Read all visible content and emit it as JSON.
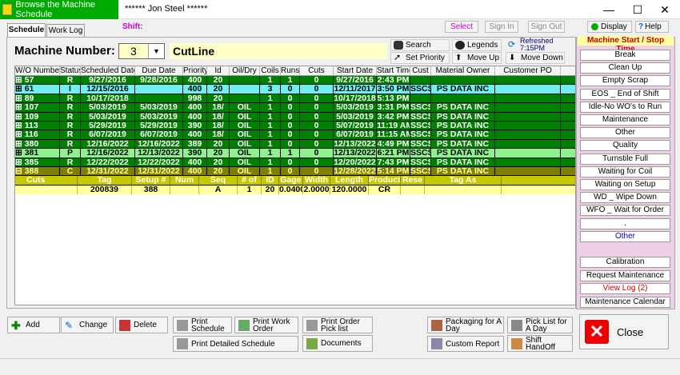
{
  "window": {
    "title": "Browse the Machine Schedule",
    "user": "****** Jon Steel ******",
    "minimize": "—",
    "maximize": "☐",
    "close": "✕"
  },
  "top_buttons": {
    "select": "Select",
    "sign_in": "Sign In",
    "sign_out": "Sign Out",
    "display": "Display",
    "help": "Help"
  },
  "shift_label": "Shift:",
  "tabs": [
    "Schedule",
    "Work Log"
  ],
  "machine": {
    "label": "Machine Number:",
    "value": "3",
    "name": "CutLine"
  },
  "toolbar": {
    "search": "Search",
    "set_priority": "Set Priority",
    "legends": "Legends",
    "move_up": "Move Up",
    "move_down": "Move Down",
    "refreshed": "Refreshed 7:15PM"
  },
  "grid": {
    "columns": [
      "W/O Number",
      "Status",
      "Scheduled Date",
      "Due Date",
      "Priority",
      "Id",
      "Oil/Dry",
      "Coils",
      "Runs",
      "Cuts",
      "Start Date",
      "Start Time",
      "Cust",
      "Material Owner",
      "Customer PO"
    ],
    "rows": [
      {
        "cells": [
          "57",
          "R",
          "9/27/2016",
          "9/28/2016",
          "400",
          "20",
          "",
          "1",
          "1",
          "0",
          "9/27/2016",
          "2:43 PM",
          "",
          "",
          ""
        ],
        "bg": "#008000",
        "fg": "#fff"
      },
      {
        "cells": [
          "61",
          "I",
          "12/15/2016",
          "",
          "400",
          "20",
          "",
          "3",
          "0",
          "0",
          "12/11/2017",
          "3:50 PM",
          "SSCS",
          "PS DATA INC",
          ""
        ],
        "bg": "#70f0f0",
        "fg": "#000"
      },
      {
        "cells": [
          "89",
          "R",
          "10/17/2018",
          "",
          "998",
          "20",
          "",
          "1",
          "0",
          "0",
          "10/17/2018",
          "5:13 PM",
          "",
          "",
          ""
        ],
        "bg": "#008000",
        "fg": "#fff"
      },
      {
        "cells": [
          "107",
          "R",
          "5/03/2019",
          "5/03/2019",
          "400",
          "18/",
          "OIL",
          "1",
          "0",
          "0",
          "5/03/2019",
          "3:31 PM",
          "SSCS",
          "PS DATA INC",
          ""
        ],
        "bg": "#008000",
        "fg": "#fff"
      },
      {
        "cells": [
          "109",
          "R",
          "5/03/2019",
          "5/03/2019",
          "400",
          "18/",
          "OIL",
          "1",
          "0",
          "0",
          "5/03/2019",
          "3:42 PM",
          "SSCS",
          "PS DATA INC",
          ""
        ],
        "bg": "#008000",
        "fg": "#fff"
      },
      {
        "cells": [
          "113",
          "R",
          "5/29/2019",
          "5/29/2019",
          "390",
          "18/",
          "OIL",
          "1",
          "0",
          "0",
          "5/07/2019",
          "11:19 AM",
          "SSCS",
          "PS DATA INC",
          ""
        ],
        "bg": "#008000",
        "fg": "#fff"
      },
      {
        "cells": [
          "116",
          "R",
          "6/07/2019",
          "6/07/2019",
          "400",
          "18/",
          "OIL",
          "1",
          "0",
          "0",
          "6/07/2019",
          "11:15 AM",
          "SSCS",
          "PS DATA INC",
          ""
        ],
        "bg": "#008000",
        "fg": "#fff"
      },
      {
        "cells": [
          "380",
          "R",
          "12/16/2022",
          "12/16/2022",
          "389",
          "20",
          "OIL",
          "1",
          "0",
          "0",
          "12/13/2022",
          "4:49 PM",
          "SSCS",
          "PS DATA INC",
          ""
        ],
        "bg": "#008000",
        "fg": "#fff"
      },
      {
        "cells": [
          "381",
          "P",
          "12/16/2022",
          "12/13/2022",
          "390",
          "20",
          "OIL",
          "1",
          "1",
          "0",
          "12/13/2022",
          "6:21 PM",
          "SSCS",
          "PS DATA INC",
          ""
        ],
        "bg": "#90f090",
        "fg": "#000"
      },
      {
        "cells": [
          "385",
          "R",
          "12/22/2022",
          "12/22/2022",
          "400",
          "20",
          "OIL",
          "1",
          "0",
          "0",
          "12/20/2022",
          "7:43 PM",
          "SSCS",
          "PS DATA INC",
          ""
        ],
        "bg": "#008000",
        "fg": "#fff"
      },
      {
        "cells": [
          "388",
          "C",
          "12/31/2022",
          "12/31/2022",
          "400",
          "20",
          "OIL",
          "1",
          "0",
          "0",
          "12/28/2022",
          "5:14 PM",
          "SSCS",
          "PS DATA INC",
          ""
        ],
        "bg": "#808000",
        "fg": "#ffffa0"
      }
    ],
    "sub_header": [
      "Cuts",
      "Tag",
      "Setup #",
      "Num",
      "Seq",
      "# of",
      "ID",
      "Gage",
      "Width",
      "Length",
      "Product",
      "Rese",
      "Tag As"
    ],
    "sub_row": [
      "",
      "200839",
      "388",
      "",
      "A",
      "1",
      "20",
      "0.0400",
      "2.0000",
      "120.0000",
      "CR",
      "",
      ""
    ]
  },
  "right_panel": {
    "title": "Machine Start / Stop Time",
    "buttons": [
      "Break",
      "Clean Up",
      "Empty Scrap",
      "EOS _ End of Shift",
      "Idle-No WO's to Run",
      "Maintenance",
      "Other",
      "Quality",
      "Turnstile Full",
      "Waiting for Coil",
      "Waiting on Setup",
      "WD _ Wipe Down",
      "WFO _ Wait for Order",
      ".",
      "Other"
    ],
    "lower_buttons": [
      "Calibration",
      "Request Maintenance",
      "View Log (2)",
      "Maintenance Calendar"
    ]
  },
  "bottom": {
    "add": "Add",
    "change": "Change",
    "delete": "Delete",
    "print_schedule": "Print Schedule",
    "print_work_order": "Print Work Order",
    "print_order_pick_list": "Print Order Pick list",
    "print_detailed_schedule": "Print Detailed Schedule",
    "documents": "Documents",
    "packaging": "Packaging for A Day",
    "pick_list": "Pick List for A Day",
    "custom_report": "Custom Report",
    "shift_handoff": "Shift HandOff",
    "close": "Close"
  }
}
